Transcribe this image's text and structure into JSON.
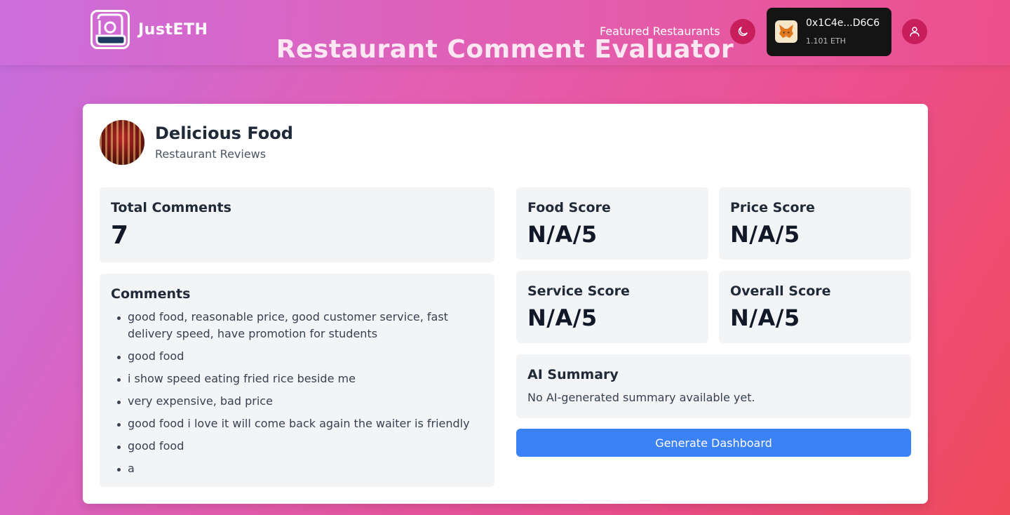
{
  "header": {
    "brand": "JustETH",
    "page_title": "Restaurant Comment Evaluator",
    "nav_link": "Featured Restaurants",
    "wallet": {
      "address": "0x1C4e...D6C6",
      "balance": "1.101 ETH"
    }
  },
  "restaurant": {
    "name": "Delicious Food",
    "subtitle": "Restaurant Reviews"
  },
  "stats": {
    "total_comments_label": "Total Comments",
    "total_comments_value": "7"
  },
  "comments": {
    "title": "Comments",
    "items": [
      "good food, reasonable price, good customer service, fast delivery speed, have promotion for students",
      "good food",
      "i show speed eating fried rice beside me",
      "very expensive, bad price",
      "good food i love it will come back again the waiter is friendly",
      "good food",
      "a"
    ]
  },
  "scores": {
    "food": {
      "label": "Food Score",
      "value": "N/A/5"
    },
    "price": {
      "label": "Price Score",
      "value": "N/A/5"
    },
    "service": {
      "label": "Service Score",
      "value": "N/A/5"
    },
    "overall": {
      "label": "Overall Score",
      "value": "N/A/5"
    }
  },
  "summary": {
    "title": "AI Summary",
    "text": "No AI-generated summary available yet."
  },
  "actions": {
    "generate": "Generate Dashboard"
  },
  "colors": {
    "accent": "#3b82f6",
    "icon_button": "#c81e5b",
    "panel_bg": "#f3f4f6"
  },
  "icons": [
    "logo-icon",
    "moon-icon",
    "metamask-fox-icon",
    "user-icon"
  ]
}
